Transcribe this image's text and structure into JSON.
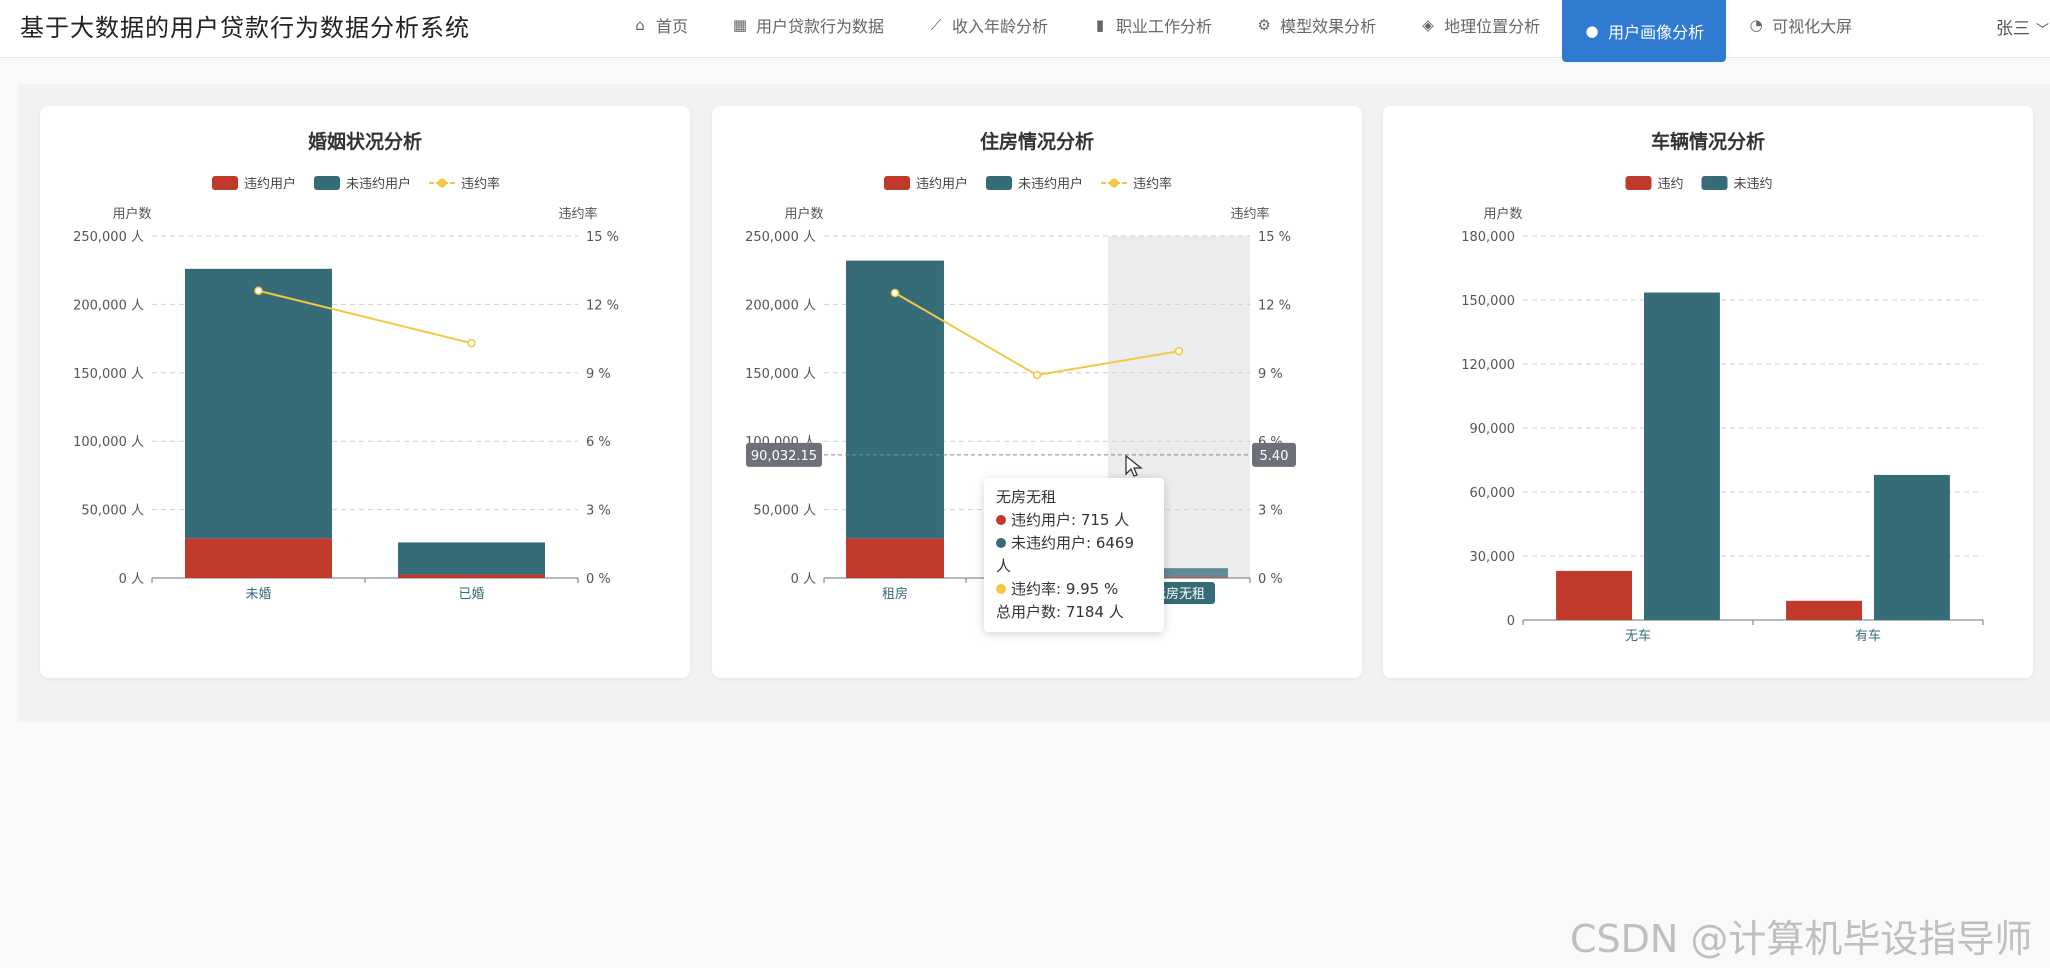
{
  "header": {
    "title": "基于大数据的用户贷款行为数据分析系统",
    "nav": [
      {
        "label": "首页",
        "icon": "home-icon",
        "glyph": "⌂"
      },
      {
        "label": "用户贷款行为数据",
        "icon": "table-icon",
        "glyph": "▦"
      },
      {
        "label": "收入年龄分析",
        "icon": "line-chart-icon",
        "glyph": "⟋"
      },
      {
        "label": "职业工作分析",
        "icon": "briefcase-icon",
        "glyph": "▮"
      },
      {
        "label": "模型效果分析",
        "icon": "gears-icon",
        "glyph": "⚙"
      },
      {
        "label": "地理位置分析",
        "icon": "map-icon",
        "glyph": "◈"
      },
      {
        "label": "用户画像分析",
        "icon": "users-icon",
        "glyph": "●"
      },
      {
        "label": "可视化大屏",
        "icon": "pie-chart-icon",
        "glyph": "◔"
      }
    ],
    "active_index": 6,
    "user": "张三"
  },
  "colors": {
    "default": "#c0392b",
    "nondefault": "#366b78",
    "rate": "#f3c843"
  },
  "chart_data": [
    {
      "type": "bar",
      "title": "婚姻状况分析",
      "legend": [
        "违约用户",
        "未违约用户",
        "违约率"
      ],
      "ylabel": "用户数",
      "y2label": "违约率",
      "categories": [
        "未婚",
        "已婚"
      ],
      "series": [
        {
          "name": "违约用户",
          "values": [
            29000,
            2500
          ],
          "stack": "total"
        },
        {
          "name": "未违约用户",
          "values": [
            197000,
            23500
          ],
          "stack": "total"
        },
        {
          "name": "违约率",
          "type": "line",
          "axis": "right",
          "values": [
            12.6,
            10.3
          ]
        }
      ],
      "ylim": [
        0,
        250000
      ],
      "yticks": [
        0,
        50000,
        100000,
        150000,
        200000,
        250000
      ],
      "ytick_labels": [
        "0 人",
        "50,000 人",
        "100,000 人",
        "150,000 人",
        "200,000 人",
        "250,000 人"
      ],
      "y2lim": [
        0,
        15
      ],
      "y2ticks": [
        0,
        3,
        6,
        9,
        12,
        15
      ],
      "y2tick_labels": [
        "0 %",
        "3 %",
        "6 %",
        "9 %",
        "12 %",
        "15 %"
      ]
    },
    {
      "type": "bar",
      "title": "住房情况分析",
      "legend": [
        "违约用户",
        "未违约用户",
        "违约率"
      ],
      "ylabel": "用户数",
      "y2label": "违约率",
      "categories": [
        "租房",
        "",
        "无房无租"
      ],
      "series": [
        {
          "name": "违约用户",
          "values": [
            29000,
            0,
            715
          ],
          "stack": "total"
        },
        {
          "name": "未违约用户",
          "values": [
            203000,
            0,
            6469
          ],
          "stack": "total"
        },
        {
          "name": "违约率",
          "type": "line",
          "axis": "right",
          "values": [
            12.5,
            8.9,
            9.95
          ]
        }
      ],
      "ylim": [
        0,
        250000
      ],
      "yticks": [
        0,
        50000,
        100000,
        150000,
        200000,
        250000
      ],
      "ytick_labels": [
        "0 人",
        "50,000 人",
        "100,000 人",
        "150,000 人",
        "200,000 人",
        "250,000 人"
      ],
      "y2lim": [
        0,
        15
      ],
      "y2ticks": [
        0,
        3,
        6,
        9,
        12,
        15
      ],
      "y2tick_labels": [
        "0 %",
        "3 %",
        "6 %",
        "9 %",
        "12 %",
        "15 %"
      ],
      "highlight_index": 2,
      "crosshair": {
        "left_label": "90,032.15",
        "right_label": "5.40",
        "value": 90032.15
      },
      "tooltip": {
        "title": "无房无租",
        "rows": [
          "违约用户: 715 人",
          "未违约用户: 6469 人",
          "违约率: 9.95 %"
        ],
        "total": "总用户数: 7184 人"
      }
    },
    {
      "type": "bar",
      "title": "车辆情况分析",
      "legend": [
        "违约",
        "未违约"
      ],
      "ylabel": "用户数",
      "categories": [
        "无车",
        "有车"
      ],
      "series": [
        {
          "name": "违约",
          "values": [
            23000,
            9000
          ]
        },
        {
          "name": "未违约",
          "values": [
            153500,
            68000
          ]
        }
      ],
      "ylim": [
        0,
        180000
      ],
      "yticks": [
        0,
        30000,
        60000,
        90000,
        120000,
        150000,
        180000
      ],
      "ytick_labels": [
        "0",
        "30,000",
        "60,000",
        "90,000",
        "120,000",
        "150,000",
        "180,000"
      ]
    }
  ],
  "watermark": "CSDN @计算机毕设指导师"
}
